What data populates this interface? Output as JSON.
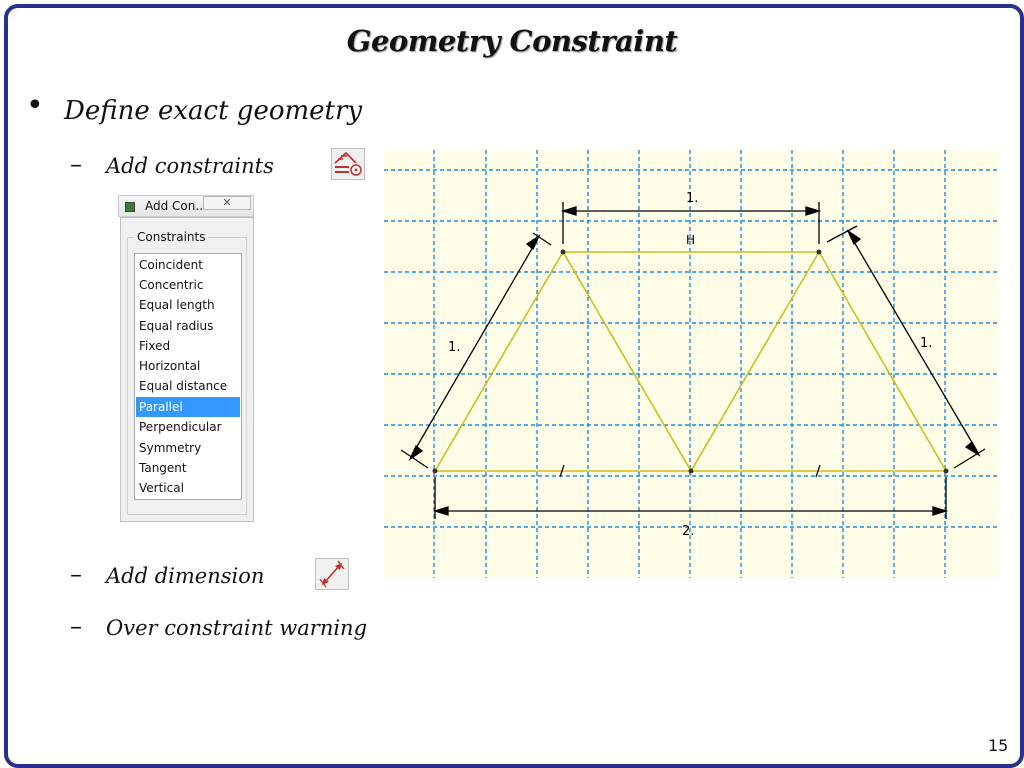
{
  "slide": {
    "title": "Geometry Constraint",
    "bullet": "Define exact geometry",
    "subitems": [
      {
        "label": "Add constraints",
        "icon": "add-constraint-icon"
      },
      {
        "label": "Add dimension",
        "icon": "add-dimension-icon"
      },
      {
        "label": "Over constraint warning"
      }
    ],
    "page_number": "15"
  },
  "dialog": {
    "title": "Add Con...",
    "close_glyph": "✕",
    "group_label": "Constraints",
    "items": [
      "Coincident",
      "Concentric",
      "Equal length",
      "Equal radius",
      "Fixed",
      "Horizontal",
      "Equal distance",
      "Parallel",
      "Perpendicular",
      "Symmetry",
      "Tangent",
      "Vertical"
    ],
    "selected": "Parallel"
  },
  "sketch": {
    "dimensions": {
      "top": "1.",
      "left": "1.",
      "right": "1.",
      "bottom": "2."
    },
    "constraint_markers": {
      "horizontal": "H",
      "parallel": "/"
    },
    "colors": {
      "grid": "#1f8be0",
      "truss": "#c8c01c",
      "background": "#fffde8",
      "dimension": "#000000"
    }
  },
  "colors": {
    "frame": "#2b2f8f",
    "selection": "#3399ff"
  }
}
